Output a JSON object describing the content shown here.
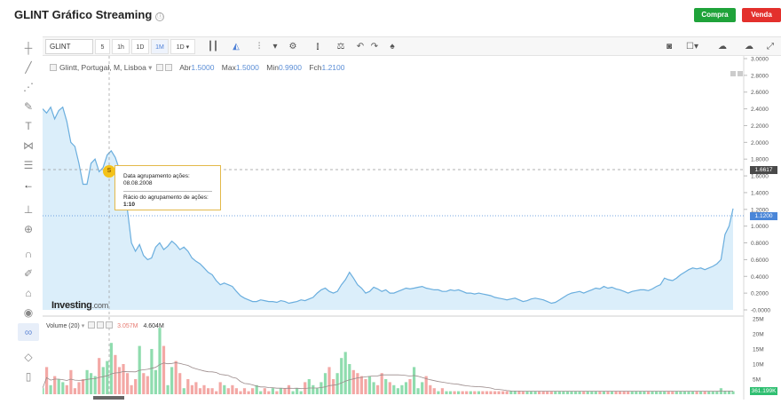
{
  "header": {
    "title": "GLINT Gráfico Streaming",
    "info_icon": "ⓘ",
    "buy_label": "Compra",
    "sell_label": "Venda"
  },
  "toolbar": {
    "symbol": "GLINT",
    "timeframes": [
      "5",
      "1h",
      "1D",
      "1M",
      "1D"
    ],
    "active_timeframe": "1M"
  },
  "legend": {
    "instrument": "Glintt, Portugal, M, Lisboa",
    "open_label": "Abr",
    "open": "1.5000",
    "high_label": "Max",
    "high": "1.5000",
    "low_label": "Min",
    "low": "0.9900",
    "close_label": "Fch",
    "close": "1.2100"
  },
  "volume_legend": {
    "label": "Volume (20)",
    "value1": "3.057M",
    "value2": "4.604M"
  },
  "tooltip": {
    "line1": "Data agrupamento ações:",
    "line2": "08.08.2008",
    "line3": "Rácio do agrupamento de ações:",
    "line4": "1:10",
    "marker": "S"
  },
  "logo": {
    "brand": "Investing",
    "suffix": ".com"
  },
  "price_axis": {
    "labels": [
      "3.0000",
      "2.8000",
      "2.6000",
      "2.4000",
      "2.2000",
      "2.0000",
      "1.8000",
      "1.6000",
      "1.4000",
      "1.2000",
      "1.0000",
      "0.8000",
      "0.6000",
      "0.4000",
      "0.2000",
      "-0.0000"
    ],
    "crosshair_price": "1.6617",
    "last_price": "1.1200"
  },
  "volume_axis": {
    "labels": [
      "25M",
      "20M",
      "15M",
      "10M",
      "5M"
    ],
    "last_volume": "361.199K"
  },
  "colors": {
    "line": "#6aaede",
    "area": "#dbeefa",
    "vol_up": "#8fdcae",
    "vol_down": "#f3a8a5",
    "last_price_bg": "#4a86d8",
    "crosshair_bg": "#4a4a4a",
    "buy": "#1fa33a",
    "sell": "#e3302c"
  },
  "chart_data": {
    "type": "area",
    "ylim": [
      0,
      3
    ],
    "values": [
      2.4,
      2.35,
      2.42,
      2.28,
      2.38,
      2.42,
      2.25,
      2.0,
      1.95,
      1.75,
      1.5,
      1.5,
      1.75,
      1.8,
      1.65,
      1.7,
      1.85,
      1.9,
      1.82,
      1.68,
      1.6,
      1.2,
      0.8,
      0.7,
      0.78,
      0.65,
      0.6,
      0.62,
      0.75,
      0.8,
      0.72,
      0.76,
      0.82,
      0.78,
      0.72,
      0.75,
      0.7,
      0.62,
      0.58,
      0.55,
      0.5,
      0.45,
      0.42,
      0.35,
      0.3,
      0.32,
      0.3,
      0.28,
      0.22,
      0.17,
      0.14,
      0.12,
      0.1,
      0.1,
      0.12,
      0.11,
      0.1,
      0.1,
      0.09,
      0.11,
      0.1,
      0.08,
      0.09,
      0.1,
      0.12,
      0.11,
      0.13,
      0.15,
      0.2,
      0.24,
      0.26,
      0.22,
      0.2,
      0.22,
      0.3,
      0.36,
      0.45,
      0.38,
      0.3,
      0.26,
      0.2,
      0.22,
      0.27,
      0.25,
      0.22,
      0.24,
      0.2,
      0.2,
      0.22,
      0.24,
      0.26,
      0.25,
      0.26,
      0.27,
      0.28,
      0.26,
      0.25,
      0.24,
      0.24,
      0.22,
      0.22,
      0.24,
      0.23,
      0.24,
      0.22,
      0.2,
      0.2,
      0.19,
      0.2,
      0.19,
      0.18,
      0.17,
      0.15,
      0.14,
      0.13,
      0.12,
      0.13,
      0.14,
      0.12,
      0.1,
      0.11,
      0.13,
      0.14,
      0.13,
      0.12,
      0.1,
      0.08,
      0.09,
      0.12,
      0.15,
      0.18,
      0.2,
      0.21,
      0.22,
      0.2,
      0.22,
      0.24,
      0.26,
      0.25,
      0.28,
      0.26,
      0.27,
      0.25,
      0.24,
      0.22,
      0.2,
      0.22,
      0.23,
      0.24,
      0.24,
      0.23,
      0.25,
      0.28,
      0.3,
      0.38,
      0.36,
      0.35,
      0.38,
      0.42,
      0.45,
      0.48,
      0.5,
      0.49,
      0.5,
      0.48,
      0.5,
      0.52,
      0.55,
      0.6,
      0.9,
      1.0,
      1.21
    ],
    "volume": [
      2,
      9,
      3,
      6,
      5,
      4,
      3,
      8,
      2,
      4,
      5,
      8,
      7,
      6,
      12,
      9,
      11,
      17,
      13,
      9,
      10,
      7,
      3,
      5,
      16,
      7,
      6,
      15,
      8,
      22,
      16,
      3,
      9,
      11,
      7,
      2,
      5,
      3,
      4,
      2,
      3,
      2,
      2,
      1,
      4,
      3,
      2,
      3,
      2,
      1,
      2,
      1,
      2,
      3,
      1,
      2,
      1,
      2,
      1,
      2,
      2,
      3,
      1,
      2,
      1,
      4,
      5,
      3,
      2,
      4,
      7,
      9,
      5,
      7,
      12,
      14,
      10,
      8,
      7,
      6,
      5,
      6,
      4,
      3,
      7,
      5,
      4,
      3,
      2,
      3,
      4,
      5,
      9,
      2,
      4,
      6,
      3,
      2,
      1,
      2,
      1,
      1,
      1,
      1,
      1,
      1,
      1,
      1,
      1,
      1,
      1,
      1,
      1,
      1,
      1,
      1,
      1,
      1,
      1,
      1,
      1,
      1,
      1,
      1,
      1,
      1,
      1,
      1,
      1,
      1,
      1,
      1,
      1,
      1,
      1,
      1,
      1,
      1,
      1,
      1,
      1,
      1,
      1,
      1,
      1,
      1,
      1,
      1,
      1,
      1,
      1,
      1,
      1,
      1,
      1,
      1,
      1,
      1,
      1,
      1,
      1,
      1,
      1,
      1,
      1,
      1,
      1,
      1,
      2,
      1,
      1,
      1
    ],
    "volume_ylim": [
      0,
      25
    ]
  }
}
